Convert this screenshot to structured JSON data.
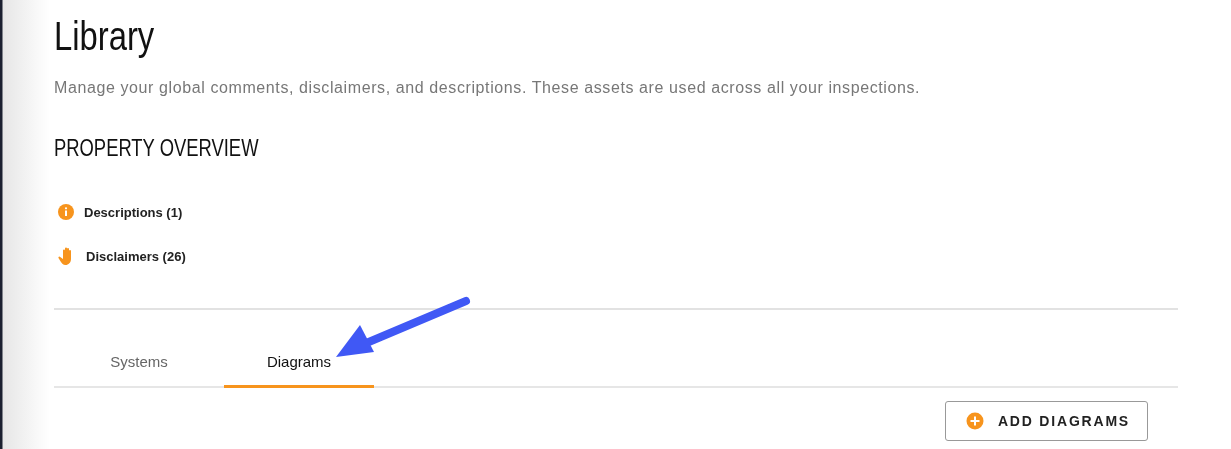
{
  "page": {
    "title": "Library",
    "subtitle": "Manage your global comments, disclaimers, and descriptions. These assets are used across all your inspections."
  },
  "section": {
    "title": "PROPERTY OVERVIEW",
    "items": [
      {
        "kind": "info",
        "label": "Descriptions (1)"
      },
      {
        "kind": "hand",
        "label": "Disclaimers (26)"
      }
    ]
  },
  "tabs": [
    {
      "label": "Systems",
      "selected": false
    },
    {
      "label": "Diagrams",
      "selected": true
    }
  ],
  "add_button": {
    "label": "ADD DIAGRAMS"
  }
}
